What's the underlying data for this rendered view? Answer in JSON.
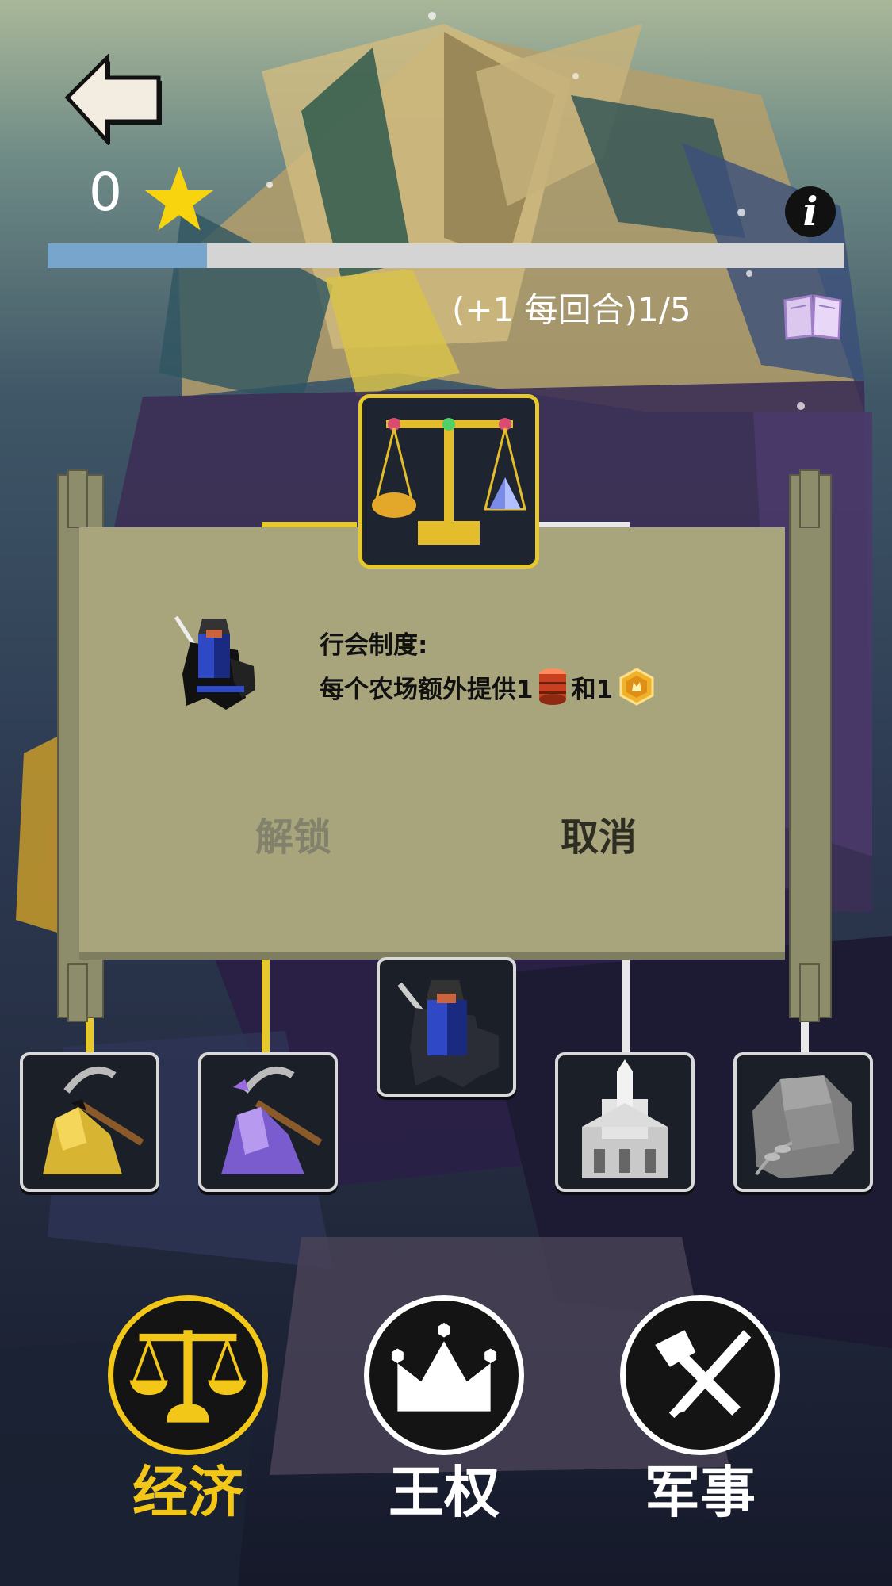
{
  "header": {
    "star_count": "0",
    "progress_fraction": 0.2,
    "turn_text": "(+1 每回合)1/5",
    "back_icon": "back-arrow-icon",
    "star_icon": "star-icon",
    "info_icon_text": "i",
    "book_icon": "book-icon"
  },
  "dialog": {
    "tech_name": "行会制度:",
    "description_prefix": "每个农场额外提供1",
    "description_middle": "和1",
    "barrel_icon": "barrel-icon",
    "coin_icon": "gold-coin-icon",
    "unlock_label": "解锁",
    "cancel_label": "取消"
  },
  "tech_tree": {
    "nodes": [
      {
        "name": "gold-mining",
        "icon": "gold-pickaxe-icon"
      },
      {
        "name": "crystal-mining",
        "icon": "crystal-pickaxe-icon"
      },
      {
        "name": "knight",
        "icon": "knight-icon"
      },
      {
        "name": "castle",
        "icon": "castle-icon"
      },
      {
        "name": "stone",
        "icon": "stone-icon"
      }
    ],
    "selected_icon": "balance-scale-icon"
  },
  "tabs": [
    {
      "label": "经济",
      "icon": "scale-icon",
      "active": true
    },
    {
      "label": "王权",
      "icon": "crown-icon",
      "active": false
    },
    {
      "label": "军事",
      "icon": "crossed-weapons-icon",
      "active": false
    }
  ],
  "colors": {
    "accent_gold": "#f3c718",
    "progress_fill": "#77a5cb",
    "scroll_paper": "#a8a57d"
  }
}
